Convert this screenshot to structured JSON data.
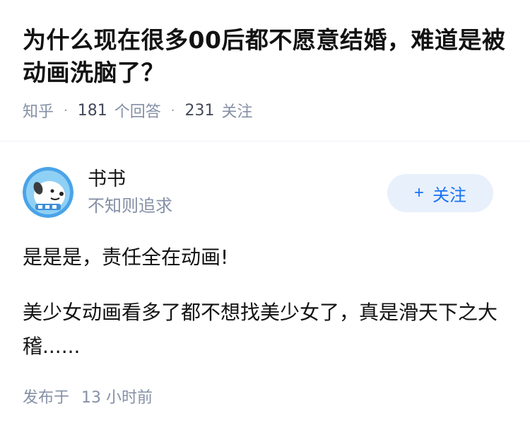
{
  "question": {
    "title": "为什么现在很多00后都不愿意结婚，难道是被动画洗脑了？",
    "source": "知乎",
    "answer_count": "181",
    "answer_label": "个回答",
    "follower_count": "231",
    "follower_label": "关注"
  },
  "answer": {
    "author": {
      "name": "书书",
      "bio": "不知则追求",
      "avatar_icon": "cartoon-dog-avatar-icon"
    },
    "follow_button": {
      "label": "关注",
      "icon": "plus-icon"
    },
    "paragraphs": [
      "是是是，责任全在动画!",
      "美少女动画看多了都不想找美少女了，真是滑天下之大稽......"
    ],
    "time_label": "发布于",
    "time_value": "13 小时前"
  },
  "colors": {
    "accent": "#1772f6",
    "follow_bg": "#e8f0fb",
    "meta_gray": "#8590a6",
    "text": "#121212"
  }
}
